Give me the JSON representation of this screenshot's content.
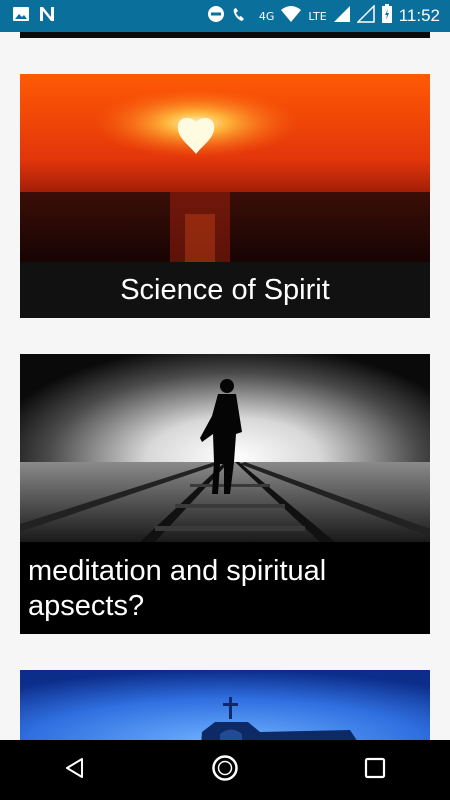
{
  "status_bar": {
    "time": "11:52",
    "network_4g": "4G",
    "network_lte": "LTE",
    "icons": [
      "image-icon",
      "n-notification-icon",
      "do-not-disturb-icon",
      "wifi-icon",
      "signal-icon",
      "battery-icon"
    ]
  },
  "cards": [
    {
      "title": "Science of Spirit",
      "image": "sunset-heart-sun-over-sea"
    },
    {
      "title": "meditation and spiritual apsects?",
      "image": "silhouette-walking-railway-tracks"
    },
    {
      "title": "",
      "image": "church-cross-blue-sky"
    }
  ],
  "colors": {
    "status_bar": "#0a6f9b",
    "background": "#f6f6f6",
    "caption_bg": "#111111",
    "nav_bar": "#000000"
  },
  "nav_bar": {
    "icons": [
      "back-icon",
      "home-icon",
      "recents-icon"
    ]
  }
}
